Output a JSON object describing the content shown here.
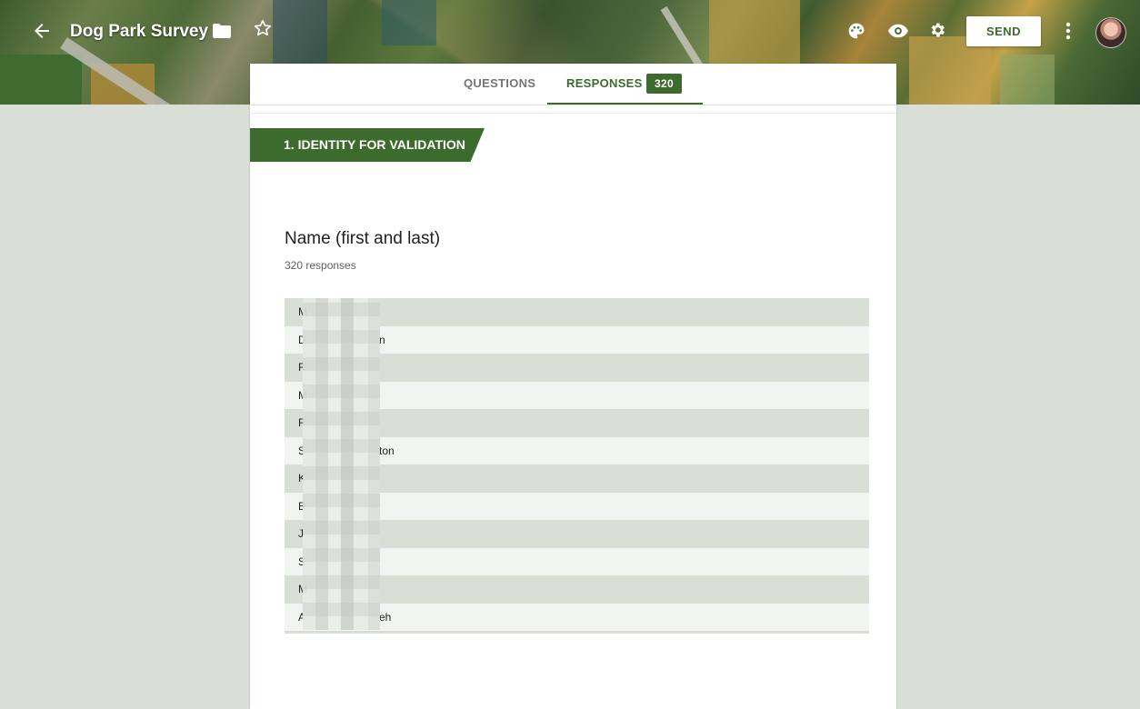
{
  "header": {
    "form_title": "Dog Park Survey",
    "send_label": "SEND"
  },
  "tabs": {
    "questions_label": "QUESTIONS",
    "responses_label": "RESPONSES",
    "responses_count": "320"
  },
  "section": {
    "title": "1. IDENTITY FOR VALIDATION"
  },
  "question": {
    "title": "Name (first and last)",
    "response_count": "320 responses",
    "responses": [
      {
        "first_char": "M",
        "tail": ""
      },
      {
        "first_char": "D",
        "tail": "n"
      },
      {
        "first_char": "R",
        "tail": ""
      },
      {
        "first_char": "M",
        "tail": ""
      },
      {
        "first_char": "R",
        "tail": ""
      },
      {
        "first_char": "S",
        "tail": "ton"
      },
      {
        "first_char": "K",
        "tail": ""
      },
      {
        "first_char": "B",
        "tail": ""
      },
      {
        "first_char": "J",
        "tail": ""
      },
      {
        "first_char": "S",
        "tail": ""
      },
      {
        "first_char": "M",
        "tail": ""
      },
      {
        "first_char": "A",
        "tail": "eh"
      }
    ]
  },
  "icons": [
    "back-arrow-icon",
    "folder-icon",
    "star-icon",
    "palette-icon",
    "eye-icon",
    "gear-icon",
    "more-vert-icon"
  ],
  "colors": {
    "accent": "#3d6b2d",
    "background": "#d9dfd7",
    "row_alt": "#f2f4f1"
  }
}
